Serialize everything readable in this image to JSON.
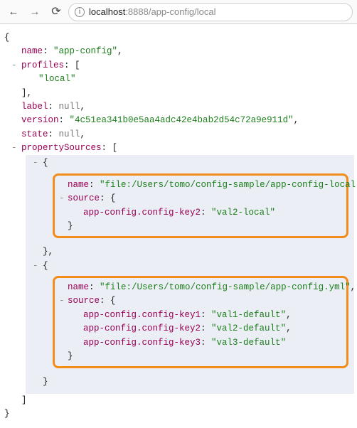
{
  "toolbar": {
    "back": "←",
    "forward": "→",
    "reload": "⟳",
    "info": "i",
    "host": "localhost",
    "port_path": ":8888/app-config/local"
  },
  "json": {
    "open_brace": "{",
    "close_brace": "}",
    "name_key": "name",
    "name_val": "\"app-config\"",
    "profiles_key": "profiles",
    "profiles_open": "[",
    "profiles_item": "\"local\"",
    "profiles_close": "]",
    "label_key": "label",
    "label_val": "null",
    "version_key": "version",
    "version_val": "\"4c51ea341b0e5aa4adc42e4bab2d54c72a9e911d\"",
    "state_key": "state",
    "state_val": "null",
    "ps_key": "propertySources",
    "ps_open": "[",
    "ps_close": "]",
    "items": [
      {
        "name_key": "name",
        "name_val": "\"file:/Users/tomo/config-sample/app-config-local.yml\"",
        "source_key": "source",
        "source_open": "{",
        "source_close": "}",
        "entries": [
          {
            "k": "app-config.config-key2",
            "v": "\"val2-local\""
          }
        ]
      },
      {
        "name_key": "name",
        "name_val": "\"file:/Users/tomo/config-sample/app-config.yml\"",
        "source_key": "source",
        "source_open": "{",
        "source_close": "}",
        "entries": [
          {
            "k": "app-config.config-key1",
            "v": "\"val1-default\""
          },
          {
            "k": "app-config.config-key2",
            "v": "\"val2-default\""
          },
          {
            "k": "app-config.config-key3",
            "v": "\"val3-default\""
          }
        ]
      }
    ]
  },
  "glyph": {
    "collapse": "-"
  }
}
